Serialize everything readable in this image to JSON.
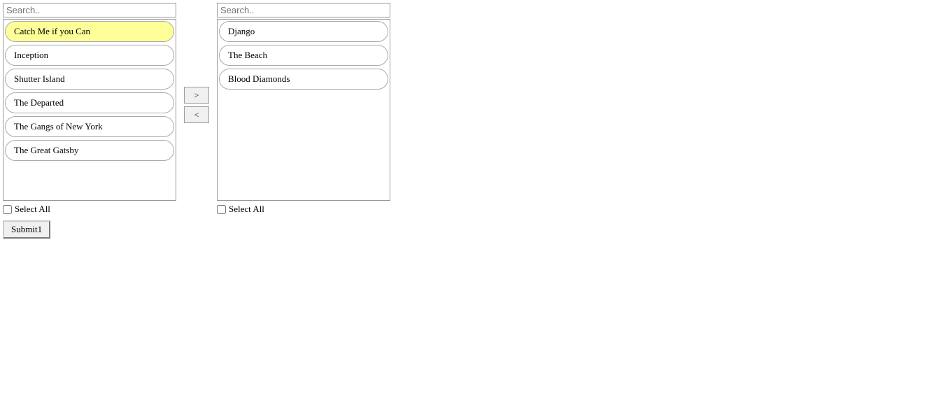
{
  "left_panel": {
    "search_placeholder": "Search..",
    "items": [
      {
        "label": "Catch Me if you Can",
        "highlighted": true
      },
      {
        "label": "Inception",
        "highlighted": false
      },
      {
        "label": "Shutter Island",
        "highlighted": false
      },
      {
        "label": "The Departed",
        "highlighted": false
      },
      {
        "label": "The Gangs of New York",
        "highlighted": false
      },
      {
        "label": "The Great Gatsby",
        "highlighted": false
      }
    ],
    "select_all_label": "Select All"
  },
  "right_panel": {
    "search_placeholder": "Search..",
    "items": [
      {
        "label": "Django",
        "highlighted": false
      },
      {
        "label": "The Beach",
        "highlighted": false
      },
      {
        "label": "Blood Diamonds",
        "highlighted": false
      }
    ],
    "select_all_label": "Select All"
  },
  "arrows": {
    "right": ">",
    "left": "<"
  },
  "submit_button": "Submit1"
}
